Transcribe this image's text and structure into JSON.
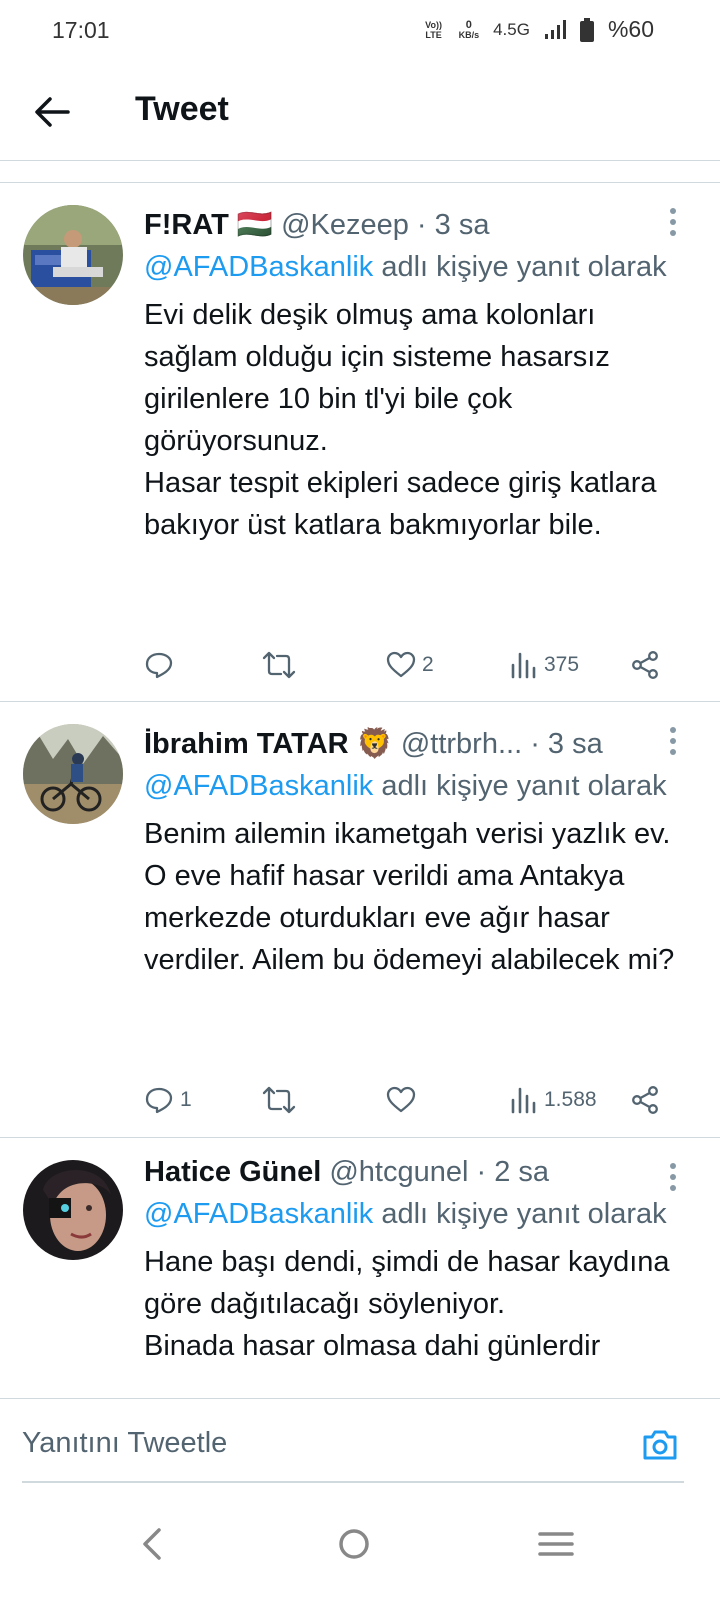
{
  "status_bar": {
    "time": "17:01",
    "volte": "Vo)) LTE",
    "speed_value": "0",
    "speed_unit": "KB/s",
    "network": "4.5G",
    "battery": "%60"
  },
  "header": {
    "title": "Tweet"
  },
  "tweets": [
    {
      "name": "F!RAT 🇭🇺",
      "handle": "@Kezeep",
      "time": "3 sa",
      "reply_mention": "@AFADBaskanlik",
      "reply_suffix": " adlı kişiye yanıt olarak",
      "text": "Evi delik deşik olmuş ama kolonları sağlam olduğu için sisteme hasarsız girilenlere 10 bin tl'yi bile çok görüyorsunuz.\nHasar tespit ekipleri sadece giriş katlara bakıyor üst katlara bakmıyorlar bile.",
      "replies": "",
      "retweets": "",
      "likes": "2",
      "views": "375"
    },
    {
      "name": "İbrahim TATAR 🦁",
      "handle": "@ttrbrh...",
      "time": "3 sa",
      "reply_mention": "@AFADBaskanlik",
      "reply_suffix": " adlı kişiye yanıt olarak",
      "text": "Benim ailemin ikametgah verisi yazlık ev. O eve hafif hasar verildi ama Antakya merkezde oturdukları eve ağır hasar verdiler. Ailem bu ödemeyi alabilecek mi?",
      "replies": "1",
      "retweets": "",
      "likes": "",
      "views": "1.588"
    },
    {
      "name": "Hatice Günel",
      "handle": "@htcgunel",
      "time": "2 sa",
      "reply_mention": "@AFADBaskanlik",
      "reply_suffix": " adlı kişiye yanıt olarak",
      "text": "Hane başı dendi, şimdi de hasar kaydına göre dağıtılacağı söyleniyor.\nBinada hasar olmasa dahi günlerdir",
      "replies": "",
      "retweets": "",
      "likes": "",
      "views": ""
    }
  ],
  "reply_bar": {
    "placeholder": "Yanıtını Tweetle"
  },
  "colors": {
    "accent": "#1d9bf0",
    "secondary_text": "#536471",
    "divider": "#cfd9de"
  }
}
